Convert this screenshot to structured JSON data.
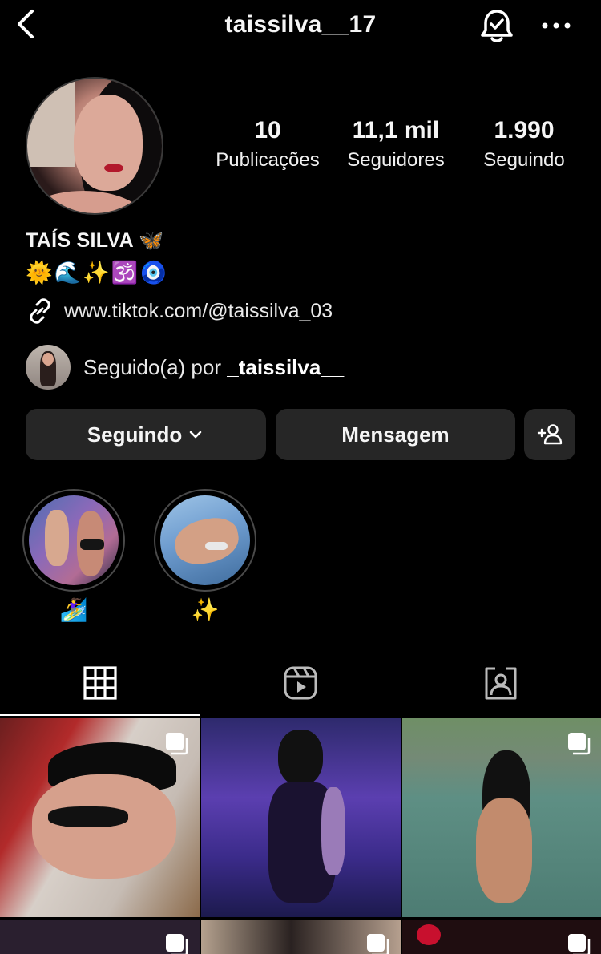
{
  "header": {
    "username": "taissilva__17",
    "back_icon": "chevron-left-icon",
    "bell_icon": "bell-check-icon",
    "more_icon": "more-horizontal-icon"
  },
  "profile": {
    "stats": [
      {
        "value": "10",
        "label": "Publicações"
      },
      {
        "value": "11,1 mil",
        "label": "Seguidores"
      },
      {
        "value": "1.990",
        "label": "Seguindo"
      }
    ],
    "full_name": "TAÍS SILVA 🦋",
    "bio": "🌞🌊✨🕉️🧿",
    "link": "www.tiktok.com/@taissilva_03",
    "followed_by_prefix": "Seguido(a) por ",
    "followed_by_user": "_taissilva__"
  },
  "actions": {
    "following_label": "Seguindo",
    "message_label": "Mensagem",
    "add_user_icon": "add-person-icon"
  },
  "highlights": [
    {
      "label": "🏄‍♀️"
    },
    {
      "label": "✨"
    }
  ],
  "tabs": [
    {
      "name": "grid",
      "icon": "grid-icon",
      "active": true
    },
    {
      "name": "reels",
      "icon": "reels-icon",
      "active": false
    },
    {
      "name": "tagged",
      "icon": "tagged-person-icon",
      "active": false
    }
  ],
  "colors": {
    "background": "#000000",
    "button": "#262626",
    "text": "#f5f5f5"
  }
}
